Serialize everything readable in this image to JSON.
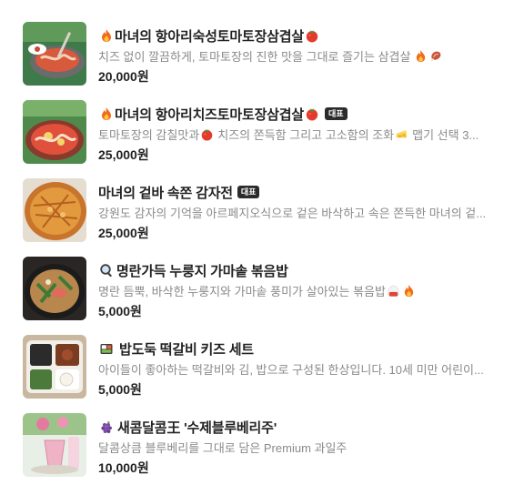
{
  "menu_items": [
    {
      "title": "마녀의 항아리숙성토마토장삼겹살",
      "title_icons": [
        "fire-icon",
        "tomato-icon"
      ],
      "badge": "",
      "description": "치즈 없이 깔끔하게, 토마토장의 진한 맛을 그대로 즐기는 삼겹살",
      "description_icons": [
        "fire-icon",
        "meat-icon"
      ],
      "price": "20,000원"
    },
    {
      "title": "마녀의 항아리치즈토마토장삼겹살",
      "title_icons": [
        "fire-icon",
        "tomato-icon"
      ],
      "badge": "대표",
      "description_a": "토마토장의 감칠맛과",
      "description_b": "치즈의 쫀득함 그리고 고소함의 조화",
      "description_c": "맵기 선택 3...",
      "description_icons": [
        "tomato-icon",
        "cheese-icon"
      ],
      "price": "25,000원"
    },
    {
      "title": "마녀의 겉바 속쫀 감자전",
      "badge": "대표",
      "description": "강원도 감자의 기억을 아르페지오식으로 겉은 바삭하고 속은 쫀득한 마녀의 겉...",
      "price": "25,000원"
    },
    {
      "title": "명란가득 누룽지 가마솥 볶음밥",
      "title_icons": [
        "magnifier-icon"
      ],
      "description": "명란 듬뿍, 바삭한 누룽지와 가마솥 풍미가 살아있는 볶음밥",
      "description_icons": [
        "rice-ball-icon",
        "fire-icon"
      ],
      "price": "5,000원"
    },
    {
      "title": "밥도둑 떡갈비 키즈 세트",
      "title_icons": [
        "bento-icon"
      ],
      "description": "아이들이 좋아하는 떡갈비와 김, 밥으로 구성된 한상입니다. 10세 미만 어린이...",
      "price": "5,000원"
    },
    {
      "title": "새콤달콤王 '수제블루베리주'",
      "title_icons": [
        "grapes-icon"
      ],
      "description": "달콤상큼 블루베리를 그대로 담은 Premium 과일주",
      "price": "10,000원"
    }
  ],
  "colors": {
    "title": "#222222",
    "description": "#8a8a8a",
    "price": "#222222",
    "badge_bg": "#2b2b2b",
    "badge_text": "#ffffff"
  }
}
